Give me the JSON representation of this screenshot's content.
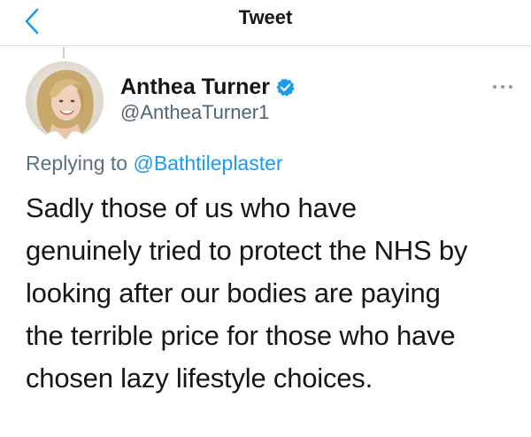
{
  "header": {
    "title": "Tweet",
    "back_icon": "chevron-left-icon"
  },
  "author": {
    "name": "Anthea Turner",
    "handle": "@AntheaTurner1",
    "verified": true,
    "verified_color": "#1d9bf0"
  },
  "reply": {
    "prefix": "Replying to",
    "mention": "@Bathtileplaster"
  },
  "tweet": {
    "text": "Sadly those of us who have\ngenuinely tried to protect the NHS by\nlooking after our bodies are paying\nthe terrible price for those who have\nchosen lazy lifestyle choices."
  },
  "colors": {
    "accent": "#1d9bf0",
    "secondary_text": "#5b7083",
    "primary_text": "#14171a"
  },
  "icons": {
    "more": "more-horizontal-icon",
    "verified": "verified-badge-icon"
  }
}
